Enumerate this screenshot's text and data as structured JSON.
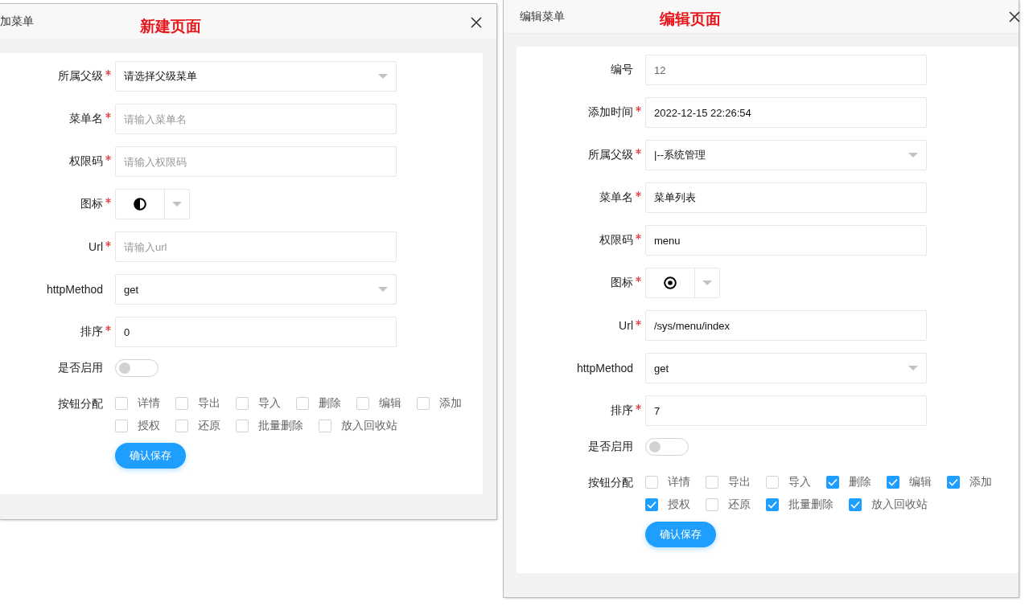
{
  "dialogs": [
    {
      "title": "加菜单",
      "annotation": "新建页面",
      "fields": [
        {
          "kind": "select",
          "label": "所属父级",
          "required": true,
          "value": "请选择父级菜单"
        },
        {
          "kind": "input",
          "label": "菜单名",
          "required": true,
          "placeholder": "请输入菜单名"
        },
        {
          "kind": "input",
          "label": "权限码",
          "required": true,
          "placeholder": "请输入权限码"
        },
        {
          "kind": "icon",
          "label": "图标",
          "required": true
        },
        {
          "kind": "input",
          "label": "Url",
          "required": true,
          "placeholder": "请输入url"
        },
        {
          "kind": "select",
          "label": "httpMethod",
          "required": false,
          "value": "get"
        },
        {
          "kind": "input",
          "label": "排序",
          "required": true,
          "value": "0"
        },
        {
          "kind": "switch",
          "label": "是否启用",
          "required": false,
          "on": false
        },
        {
          "kind": "checkboxes",
          "label": "按钮分配",
          "required": false,
          "options": [
            {
              "label": "详情",
              "checked": false
            },
            {
              "label": "导出",
              "checked": false
            },
            {
              "label": "导入",
              "checked": false
            },
            {
              "label": "删除",
              "checked": false
            },
            {
              "label": "编辑",
              "checked": false
            },
            {
              "label": "添加",
              "checked": false
            },
            {
              "label": "授权",
              "checked": false
            },
            {
              "label": "还原",
              "checked": false
            },
            {
              "label": "批量删除",
              "checked": false
            },
            {
              "label": "放入回收站",
              "checked": false
            }
          ]
        }
      ],
      "submit": "确认保存"
    },
    {
      "title": "编辑菜单",
      "annotation": "编辑页面",
      "fields": [
        {
          "kind": "input",
          "label": "编号",
          "required": false,
          "value": "12",
          "readonly": true
        },
        {
          "kind": "input",
          "label": "添加时间",
          "required": true,
          "value": "2022-12-15 22:26:54"
        },
        {
          "kind": "select",
          "label": "所属父级",
          "required": true,
          "value": "|--系统管理"
        },
        {
          "kind": "input",
          "label": "菜单名",
          "required": true,
          "value": "菜单列表"
        },
        {
          "kind": "input",
          "label": "权限码",
          "required": true,
          "value": "menu"
        },
        {
          "kind": "icon",
          "label": "图标",
          "required": true
        },
        {
          "kind": "input",
          "label": "Url",
          "required": true,
          "value": "/sys/menu/index"
        },
        {
          "kind": "select",
          "label": "httpMethod",
          "required": false,
          "value": "get"
        },
        {
          "kind": "input",
          "label": "排序",
          "required": true,
          "value": "7"
        },
        {
          "kind": "switch",
          "label": "是否启用",
          "required": false,
          "on": false
        },
        {
          "kind": "checkboxes",
          "label": "按钮分配",
          "required": false,
          "options": [
            {
              "label": "详情",
              "checked": false
            },
            {
              "label": "导出",
              "checked": false
            },
            {
              "label": "导入",
              "checked": false
            },
            {
              "label": "删除",
              "checked": true
            },
            {
              "label": "编辑",
              "checked": true
            },
            {
              "label": "添加",
              "checked": true
            },
            {
              "label": "授权",
              "checked": true
            },
            {
              "label": "还原",
              "checked": false
            },
            {
              "label": "批量删除",
              "checked": true
            },
            {
              "label": "放入回收站",
              "checked": true
            }
          ]
        }
      ],
      "submit": "确认保存"
    }
  ]
}
